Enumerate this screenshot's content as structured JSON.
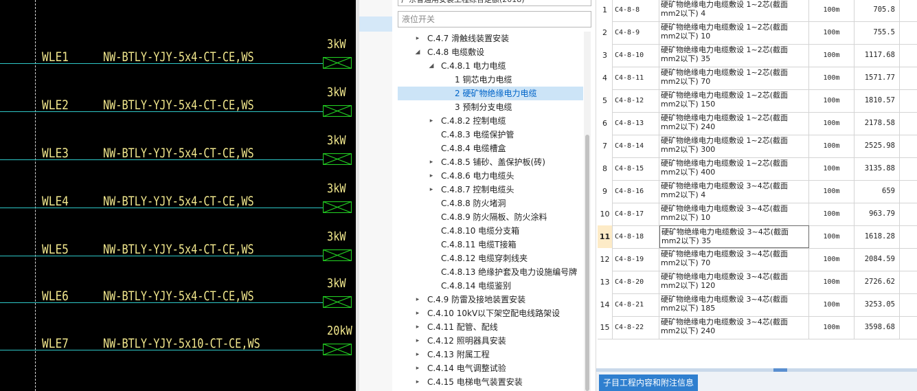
{
  "cad": {
    "rows": [
      {
        "label": "WLE1",
        "spec": "NW-BTLY-YJY-5x4-CT-CE,WS",
        "power": "3kW"
      },
      {
        "label": "WLE2",
        "spec": "NW-BTLY-YJY-5x4-CT-CE,WS",
        "power": "3kW"
      },
      {
        "label": "WLE3",
        "spec": "NW-BTLY-YJY-5x4-CT-CE,WS",
        "power": "3kW"
      },
      {
        "label": "WLE4",
        "spec": "NW-BTLY-YJY-5x4-CT-CE,WS",
        "power": "3kW"
      },
      {
        "label": "WLE5",
        "spec": "NW-BTLY-YJY-5x4-CT-CE,WS",
        "power": "3kW"
      },
      {
        "label": "WLE6",
        "spec": "NW-BTLY-YJY-5x4-CT-CE,WS",
        "power": "3kW"
      },
      {
        "label": "WLE7",
        "spec": "NW-BTLY-YJY-5x10-CT-CE,WS",
        "power": "20kW"
      }
    ],
    "colors": {
      "wire": "#2ec8c8",
      "text": "#f0e68c",
      "box": "#22cc22"
    }
  },
  "tree": {
    "top_partial": "广东省通用安装工程综合定额(2018)",
    "search_placeholder": "液位开关",
    "items": [
      {
        "text": "C.4.7 滑触线装置安装",
        "arrow": "▸",
        "level": 1
      },
      {
        "text": "C.4.8 电缆敷设",
        "arrow": "◢",
        "level": 1
      },
      {
        "text": "C.4.8.1 电力电缆",
        "arrow": "◢",
        "level": 2
      },
      {
        "text": "1 铜芯电力电缆",
        "arrow": "",
        "level": 3
      },
      {
        "text": "2 硬矿物绝缘电力电缆",
        "arrow": "",
        "level": 3,
        "selected": true
      },
      {
        "text": "3 预制分支电缆",
        "arrow": "",
        "level": 3
      },
      {
        "text": "C.4.8.2 控制电缆",
        "arrow": "▸",
        "level": 2
      },
      {
        "text": "C.4.8.3 电缆保护管",
        "arrow": "",
        "level": 2
      },
      {
        "text": "C.4.8.4 电缆槽盒",
        "arrow": "",
        "level": 2
      },
      {
        "text": "C.4.8.5 铺砂、盖保护板(砖)",
        "arrow": "▸",
        "level": 2
      },
      {
        "text": "C.4.8.6 电力电缆头",
        "arrow": "▸",
        "level": 2
      },
      {
        "text": "C.4.8.7 控制电缆头",
        "arrow": "▸",
        "level": 2
      },
      {
        "text": "C.4.8.8 防火堵洞",
        "arrow": "",
        "level": 2
      },
      {
        "text": "C.4.8.9 防火隔板、防火涂料",
        "arrow": "",
        "level": 2
      },
      {
        "text": "C.4.8.10 电缆分支箱",
        "arrow": "",
        "level": 2
      },
      {
        "text": "C.4.8.11 电缆T接箱",
        "arrow": "",
        "level": 2
      },
      {
        "text": "C.4.8.12 电缆穿刺线夹",
        "arrow": "",
        "level": 2
      },
      {
        "text": "C.4.8.13 绝缘护套及电力设施编号牌",
        "arrow": "",
        "level": 2
      },
      {
        "text": "C.4.8.14 电缆鉴别",
        "arrow": "",
        "level": 2
      },
      {
        "text": "C.4.9 防雷及接地装置安装",
        "arrow": "▸",
        "level": 1
      },
      {
        "text": "C.4.10 10kV以下架空配电线路架设",
        "arrow": "▸",
        "level": 1
      },
      {
        "text": "C.4.11 配管、配线",
        "arrow": "▸",
        "level": 1
      },
      {
        "text": "C.4.12 照明器具安装",
        "arrow": "▸",
        "level": 1
      },
      {
        "text": "C.4.13 附属工程",
        "arrow": "▸",
        "level": 1
      },
      {
        "text": "C.4.14 电气调整试验",
        "arrow": "▸",
        "level": 1
      },
      {
        "text": "C.4.15 电梯电气装置安装",
        "arrow": "▸",
        "level": 1
      }
    ]
  },
  "table": {
    "active_row": 11,
    "rows": [
      {
        "idx": "1",
        "code": "C4-8-8",
        "name1": "硬矿物绝缘电力电缆敷设 1~2芯(截面",
        "name2": "mm2以下) 4",
        "unit": "100m",
        "price": "705.8"
      },
      {
        "idx": "2",
        "code": "C4-8-9",
        "name1": "硬矿物绝缘电力电缆敷设 1~2芯(截面",
        "name2": "mm2以下) 10",
        "unit": "100m",
        "price": "755.5"
      },
      {
        "idx": "3",
        "code": "C4-8-10",
        "name1": "硬矿物绝缘电力电缆敷设 1~2芯(截面",
        "name2": "mm2以下) 35",
        "unit": "100m",
        "price": "1117.68"
      },
      {
        "idx": "4",
        "code": "C4-8-11",
        "name1": "硬矿物绝缘电力电缆敷设 1~2芯(截面",
        "name2": "mm2以下) 70",
        "unit": "100m",
        "price": "1571.77"
      },
      {
        "idx": "5",
        "code": "C4-8-12",
        "name1": "硬矿物绝缘电力电缆敷设 1~2芯(截面",
        "name2": "mm2以下) 150",
        "unit": "100m",
        "price": "1810.57"
      },
      {
        "idx": "6",
        "code": "C4-8-13",
        "name1": "硬矿物绝缘电力电缆敷设 1~2芯(截面",
        "name2": "mm2以下) 240",
        "unit": "100m",
        "price": "2178.58"
      },
      {
        "idx": "7",
        "code": "C4-8-14",
        "name1": "硬矿物绝缘电力电缆敷设 1~2芯(截面",
        "name2": "mm2以下) 300",
        "unit": "100m",
        "price": "2525.98"
      },
      {
        "idx": "8",
        "code": "C4-8-15",
        "name1": "硬矿物绝缘电力电缆敷设 1~2芯(截面",
        "name2": "mm2以下) 400",
        "unit": "100m",
        "price": "3135.88"
      },
      {
        "idx": "9",
        "code": "C4-8-16",
        "name1": "硬矿物绝缘电力电缆敷设 3~4芯(截面",
        "name2": "mm2以下) 4",
        "unit": "100m",
        "price": "659"
      },
      {
        "idx": "10",
        "code": "C4-8-17",
        "name1": "硬矿物绝缘电力电缆敷设 3~4芯(截面",
        "name2": "mm2以下) 10",
        "unit": "100m",
        "price": "963.79"
      },
      {
        "idx": "11",
        "code": "C4-8-18",
        "name1": "硬矿物绝缘电力电缆敷设 3~4芯(截面",
        "name2": "mm2以下) 35",
        "unit": "100m",
        "price": "1618.28"
      },
      {
        "idx": "12",
        "code": "C4-8-19",
        "name1": "硬矿物绝缘电力电缆敷设 3~4芯(截面",
        "name2": "mm2以下) 70",
        "unit": "100m",
        "price": "2084.59"
      },
      {
        "idx": "13",
        "code": "C4-8-20",
        "name1": "硬矿物绝缘电力电缆敷设 3~4芯(截面",
        "name2": "mm2以下) 120",
        "unit": "100m",
        "price": "2726.62"
      },
      {
        "idx": "14",
        "code": "C4-8-21",
        "name1": "硬矿物绝缘电力电缆敷设 3~4芯(截面",
        "name2": "mm2以下) 185",
        "unit": "100m",
        "price": "3253.05"
      },
      {
        "idx": "15",
        "code": "C4-8-22",
        "name1": "硬矿物绝缘电力电缆敷设 3~4芯(截面",
        "name2": "mm2以下) 240",
        "unit": "100m",
        "price": "3598.68"
      }
    ]
  },
  "bottom": {
    "tab_label": "子目工程内容和附注信息"
  }
}
